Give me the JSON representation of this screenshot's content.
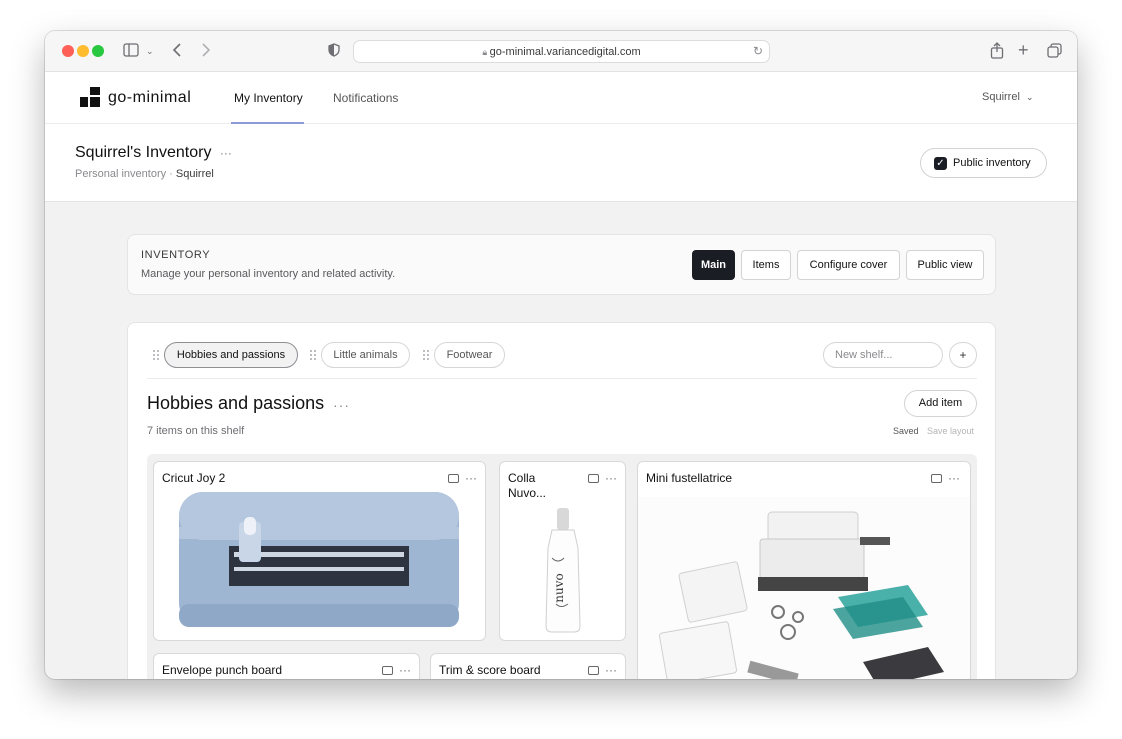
{
  "browser": {
    "url": "go-minimal.variancedigital.com"
  },
  "app": {
    "logo_text": "go-minimal",
    "nav": [
      {
        "label": "My Inventory",
        "active": true
      },
      {
        "label": "Notifications",
        "active": false
      }
    ],
    "user_menu": "Squirrel"
  },
  "page": {
    "title": "Squirrel's Inventory",
    "title_menu": "···",
    "breadcrumb_prefix": "Personal inventory · ",
    "breadcrumb_owner": "Squirrel",
    "public_toggle_label": "Public inventory",
    "public_toggle_checked": true
  },
  "inventory_card": {
    "eyebrow": "INVENTORY",
    "description": "Manage your personal inventory and related activity.",
    "buttons": [
      {
        "label": "Main",
        "active": true
      },
      {
        "label": "Items",
        "active": false
      },
      {
        "label": "Configure cover",
        "active": false
      },
      {
        "label": "Public view",
        "active": false
      }
    ]
  },
  "shelves": {
    "tabs": [
      {
        "label": "Hobbies and passions",
        "active": true
      },
      {
        "label": "Little animals",
        "active": false
      },
      {
        "label": "Footwear",
        "active": false
      }
    ],
    "new_shelf_placeholder": "New shelf...",
    "add_shelf_symbol": "+",
    "current": {
      "title": "Hobbies and passions",
      "menu": "···",
      "add_item_label": "Add item",
      "item_count_text": "7 items on this shelf",
      "saved_label": "Saved",
      "save_layout_label": "Save layout"
    }
  },
  "items": [
    {
      "title": "Cricut Joy 2",
      "image": "cutting-machine-image"
    },
    {
      "title": "Colla Nuvo...",
      "image": "glue-bottle-image"
    },
    {
      "title": "Mini fustellatrice",
      "image": "die-cutting-kit-image"
    },
    {
      "title": "Envelope punch board",
      "image": ""
    },
    {
      "title": "Trim & score board",
      "image": ""
    }
  ],
  "icons": {
    "comment": "comment-icon",
    "more": "more-icon"
  },
  "colors": {
    "accent_dark": "#1a1d24",
    "nav_underline": "#8e9ad8",
    "page_bg": "#f2f2f3"
  }
}
